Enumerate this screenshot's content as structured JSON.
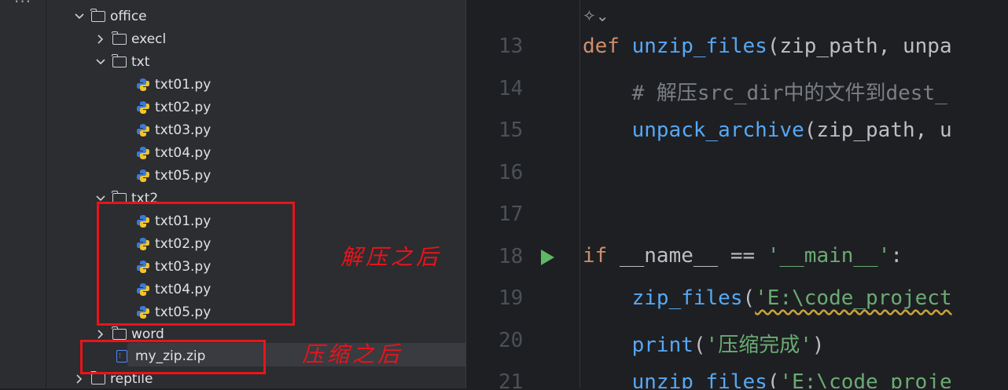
{
  "toolstrip": {
    "more_glyph": "···"
  },
  "tree": {
    "office": "office",
    "execl": "execl",
    "txt": "txt",
    "txt_files": [
      "txt01.py",
      "txt02.py",
      "txt03.py",
      "txt04.py",
      "txt05.py"
    ],
    "txt2": "txt2",
    "txt2_files": [
      "txt01.py",
      "txt02.py",
      "txt03.py",
      "txt04.py",
      "txt05.py"
    ],
    "word": "word",
    "zip_file": "my_zip.zip",
    "reptile": "reptile"
  },
  "annotations": {
    "after_unzip": "解压之后",
    "after_zip": "压缩之后"
  },
  "editor": {
    "line_numbers": [
      "13",
      "14",
      "15",
      "16",
      "17",
      "18",
      "19",
      "20",
      "21"
    ],
    "l13_def": "def ",
    "l13_fn": "unzip_files",
    "l13_rest": "(zip_path, unpa",
    "l14": "    # 解压src_dir中的文件到dest_",
    "l15_fn": "    unpack_archive",
    "l15_rest": "(zip_path, u",
    "l18_if": "if ",
    "l18_name": "__name__",
    "l18_eq": " == ",
    "l18_str": "'__main__'",
    "l18_colon": ":",
    "l19_fn": "    zip_files",
    "l19_paren": "(",
    "l19_str": "'E:\\code_project",
    "l20_fn": "    print",
    "l20_paren": "(",
    "l20_str": "'压缩完成'",
    "l20_close": ")",
    "l21_fn": "    unzip_files",
    "l21_paren": "(",
    "l21_str": "'E:\\code_proje"
  },
  "colors": {
    "accent_red": "#e8141b",
    "run_green": "#5fb865"
  }
}
